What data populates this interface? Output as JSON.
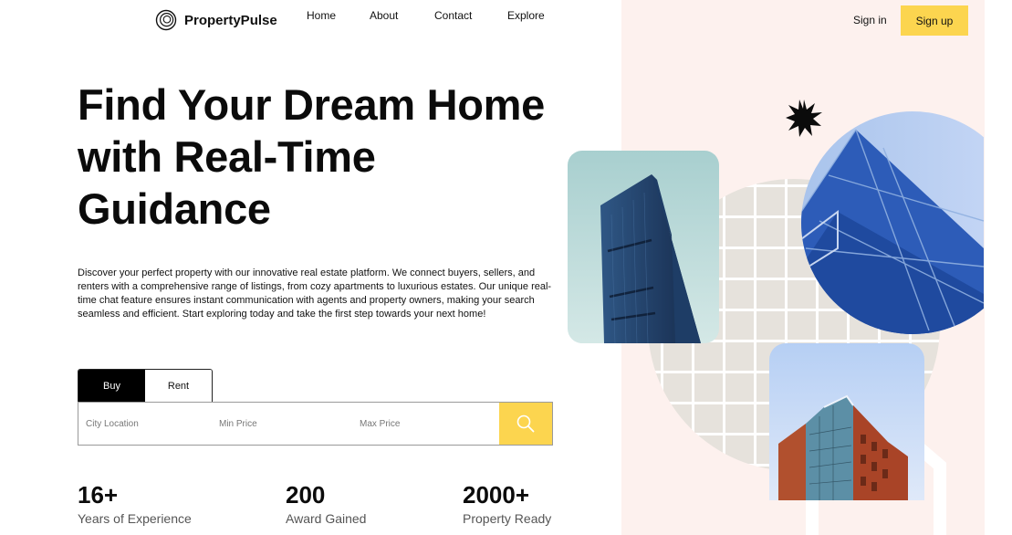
{
  "brand": {
    "name": "PropertyPulse",
    "icon": "swirl-logo-icon"
  },
  "nav": {
    "links": [
      "Home",
      "About",
      "Contact",
      "Explore"
    ],
    "sign_in": "Sign in",
    "sign_up": "Sign up"
  },
  "hero": {
    "title_line1": "Find Your Dream Home",
    "title_line2": "with Real-Time",
    "title_line3": "Guidance",
    "description": "Discover your perfect property with our innovative real estate platform. We connect buyers, sellers, and renters with a comprehensive range of listings, from cozy apartments to luxurious estates. Our unique real-time chat feature ensures instant communication with agents and property owners, making your search seamless and efficient. Start exploring today and take the first step towards your next home!"
  },
  "search": {
    "tabs": [
      "Buy",
      "Rent"
    ],
    "active_tab": "Buy",
    "city_placeholder": "City Location",
    "min_price_placeholder": "Min Price",
    "max_price_placeholder": "Max Price",
    "button_icon": "search-icon"
  },
  "stats": [
    {
      "value": "16+",
      "label": "Years of Experience"
    },
    {
      "value": "200",
      "label": "Award Gained"
    },
    {
      "value": "2000+",
      "label": "Property Ready"
    }
  ],
  "colors": {
    "accent": "#fcd54f",
    "panel_bg": "#fdf1ee",
    "text": "#0b0b0b"
  }
}
